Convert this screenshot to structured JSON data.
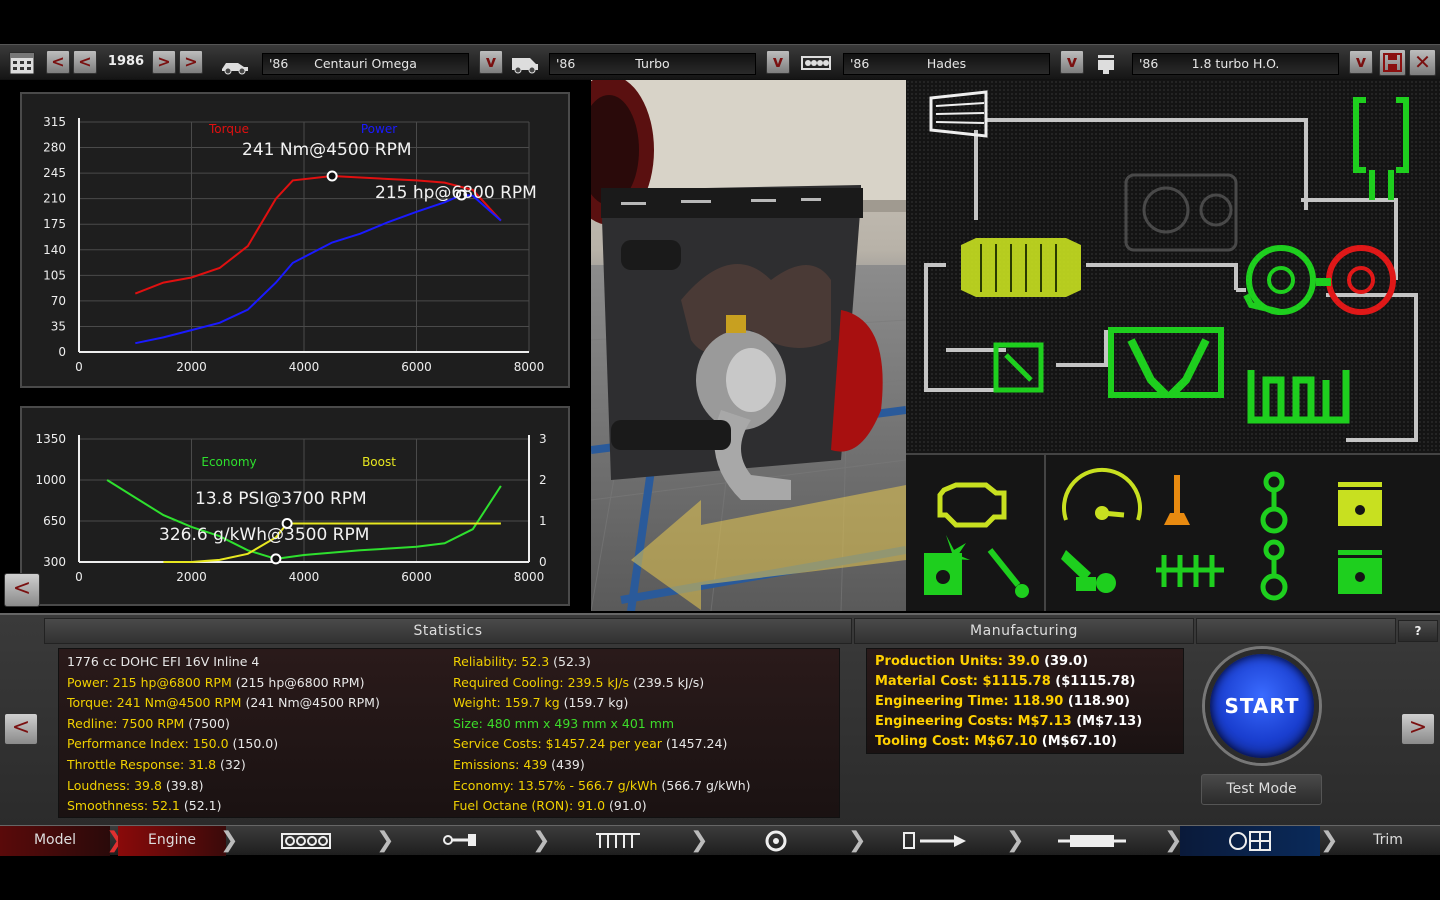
{
  "top": {
    "year": "1986",
    "model": {
      "year": "'86",
      "name": "Centauri Omega"
    },
    "trim": {
      "year": "'86",
      "name": "Turbo"
    },
    "family": {
      "year": "'86",
      "name": "Hades"
    },
    "variant": {
      "year": "'86",
      "name": "1.8 turbo H.O."
    },
    "icons": [
      "calendar-icon",
      "car-icon",
      "van-icon",
      "engine-block-icon",
      "piston-icon",
      "save-icon",
      "close-icon"
    ]
  },
  "graph1": {
    "legend_torque": "Torque",
    "legend_power": "Power",
    "peak_torque": "241 Nm@4500 RPM",
    "peak_power": "215 hp@6800 RPM",
    "y_ticks": [
      "315",
      "280",
      "245",
      "210",
      "175",
      "140",
      "105",
      "70",
      "35",
      "0"
    ],
    "x_ticks": [
      "0",
      "2000",
      "4000",
      "6000",
      "8000"
    ]
  },
  "graph2": {
    "legend_economy": "Economy",
    "legend_boost": "Boost",
    "peak_boost": "13.8 PSI@3700 RPM",
    "peak_economy": "326.6 g/kWh@3500 RPM",
    "y_ticks_left": [
      "1350",
      "1000",
      "650",
      "300"
    ],
    "y_ticks_right": [
      "3",
      "2",
      "1",
      "0"
    ],
    "x_ticks": [
      "0",
      "2000",
      "4000",
      "6000",
      "8000"
    ]
  },
  "chart_data": [
    {
      "type": "line",
      "title": "",
      "xlabel": "",
      "ylabel": "",
      "xlim": [
        0,
        8000
      ],
      "ylim": [
        0,
        315
      ],
      "series": [
        {
          "name": "Torque",
          "color": "#e01010",
          "x": [
            1000,
            1500,
            2000,
            2500,
            3000,
            3500,
            3800,
            4500,
            5000,
            5500,
            6000,
            6500,
            7000,
            7500
          ],
          "values": [
            80,
            95,
            102,
            115,
            145,
            210,
            235,
            241,
            239,
            237,
            235,
            232,
            222,
            180
          ]
        },
        {
          "name": "Power",
          "color": "#1a1aff",
          "x": [
            1000,
            1500,
            2000,
            2500,
            3000,
            3500,
            3800,
            4500,
            5000,
            5500,
            6000,
            6500,
            6800,
            7000,
            7500
          ],
          "values": [
            12,
            20,
            30,
            40,
            58,
            95,
            122,
            150,
            162,
            178,
            192,
            205,
            215,
            214,
            180
          ]
        }
      ]
    },
    {
      "type": "line",
      "title": "",
      "xlabel": "",
      "ylabel": "",
      "xlim": [
        0,
        8000
      ],
      "ylim": [
        300,
        1350
      ],
      "y2lim": [
        0,
        3
      ],
      "series": [
        {
          "name": "Economy",
          "color": "#2ee02e",
          "x": [
            500,
            1000,
            1500,
            2000,
            2500,
            3000,
            3500,
            4000,
            5000,
            6000,
            6500,
            7000,
            7500
          ],
          "values": [
            1000,
            850,
            700,
            600,
            520,
            400,
            326.6,
            360,
            400,
            430,
            460,
            580,
            950
          ]
        },
        {
          "name": "Boost",
          "color": "#e8e820",
          "axis": "right",
          "x": [
            1500,
            2000,
            2500,
            3000,
            3500,
            3700,
            4000,
            5000,
            6000,
            7000,
            7500
          ],
          "values": [
            0,
            0,
            0.05,
            0.2,
            0.6,
            0.94,
            0.94,
            0.94,
            0.94,
            0.94,
            0.94
          ]
        }
      ]
    }
  ],
  "statistics": {
    "header": "Statistics",
    "left": [
      {
        "label": "1776 cc DOHC EFI 16V Inline 4",
        "value": "",
        "kind": "plain"
      },
      {
        "label": "Power: 215 hp@6800 RPM",
        "value": " (215 hp@6800 RPM)",
        "kind": "y"
      },
      {
        "label": "Torque: 241 Nm@4500 RPM",
        "value": " (241 Nm@4500 RPM)",
        "kind": "y"
      },
      {
        "label": "Redline: 7500 RPM",
        "value": " (7500)",
        "kind": "y"
      },
      {
        "label": "Performance Index: 150.0",
        "value": " (150.0)",
        "kind": "y"
      },
      {
        "label": "Throttle Response: 31.8",
        "value": " (32)",
        "kind": "y"
      },
      {
        "label": "Loudness: 39.8",
        "value": " (39.8)",
        "kind": "y"
      },
      {
        "label": "Smoothness: 52.1",
        "value": " (52.1)",
        "kind": "y"
      }
    ],
    "right": [
      {
        "label": "Reliability: 52.3",
        "value": " (52.3)",
        "kind": "y"
      },
      {
        "label": "Required Cooling: 239.5 kJ/s",
        "value": " (239.5 kJ/s)",
        "kind": "y"
      },
      {
        "label": "Weight: 159.7 kg",
        "value": " (159.7 kg)",
        "kind": "y"
      },
      {
        "label": "Size: 480 mm x 493 mm x 401 mm",
        "value": "",
        "kind": "g"
      },
      {
        "label": "Service Costs: $1457.24 per year",
        "value": " (1457.24)",
        "kind": "y"
      },
      {
        "label": "Emissions: 439",
        "value": " (439)",
        "kind": "y"
      },
      {
        "label": "Economy: 13.57% - 566.7 g/kWh",
        "value": " (566.7 g/kWh)",
        "kind": "y"
      },
      {
        "label": "Fuel Octane (RON): 91.0",
        "value": " (91.0)",
        "kind": "y"
      }
    ]
  },
  "manufacturing": {
    "header": "Manufacturing",
    "rows": [
      {
        "label": "Production Units: 39.0",
        "value": " (39.0)"
      },
      {
        "label": "Material Cost: $1115.78",
        "value": " ($1115.78)"
      },
      {
        "label": "Engineering Time: 118.90",
        "value": " (118.90)"
      },
      {
        "label": "Engineering Costs: M$7.13",
        "value": " (M$7.13)"
      },
      {
        "label": "Tooling Cost: M$67.10",
        "value": " (M$67.10)"
      }
    ]
  },
  "buttons": {
    "start": "START",
    "test_mode": "Test Mode",
    "help": "?"
  },
  "nav": {
    "model": "Model",
    "engine": "Engine",
    "trim": "Trim",
    "icons": [
      "block-icon",
      "crankshaft-icon",
      "head-icon",
      "turbo-icon",
      "fuel-icon",
      "exhaust-icon",
      "gauge-icon"
    ]
  }
}
